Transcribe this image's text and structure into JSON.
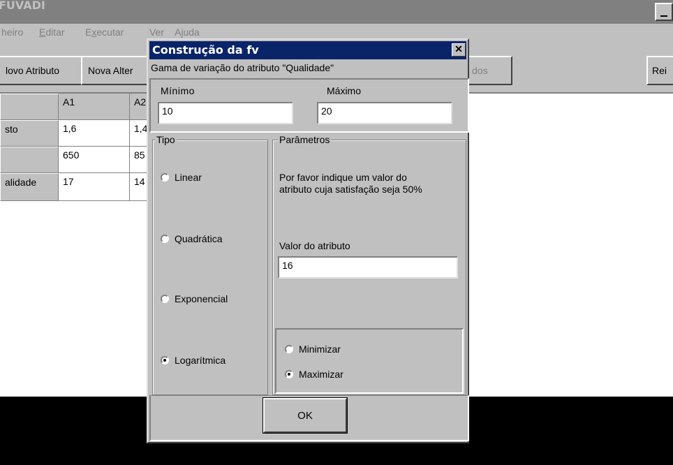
{
  "app": {
    "title": "FUVADI"
  },
  "menu": [
    {
      "label_pre": "",
      "label_ul": "",
      "label_post": "heiro"
    },
    {
      "label_pre": "",
      "label_ul": "E",
      "label_post": "ditar"
    },
    {
      "label_pre": "E",
      "label_ul": "x",
      "label_post": "ecutar"
    },
    {
      "label_pre": "",
      "label_ul": "",
      "label_post": "Ver"
    },
    {
      "label_pre": "",
      "label_ul": "",
      "label_post": "Ajuda"
    }
  ],
  "toolbar": {
    "novo_atributo": "lovo Atributo",
    "nova_alternativa": "Nova Alter",
    "resultados": "dos",
    "reiniciar": "Rei"
  },
  "table": {
    "header": [
      "",
      "A1",
      "A2"
    ],
    "rows": [
      {
        "label": "sto",
        "a1": "1,6",
        "a2": "1,4"
      },
      {
        "label": "",
        "a1": "650",
        "a2": "85"
      },
      {
        "label": "alidade",
        "a1": "17",
        "a2": "14"
      }
    ]
  },
  "dialog": {
    "title": "Construção da fv",
    "close": "✕",
    "subtitle": "Gama de variação do atributo \"Qualidade\"",
    "min_label": "Mínimo",
    "min_value": "10",
    "max_label": "Máximo",
    "max_value": "20",
    "tipo_label": "Tipo",
    "tipo_options": [
      "Linear",
      "Quadrática",
      "Exponencial",
      "Logarítmica"
    ],
    "tipo_selected": "Logarítmica",
    "params_label": "Parâmetros",
    "params_text1": "Por favor indique um valor do",
    "params_text2": "atributo cuja satisfação seja 50%",
    "valor_label": "Valor do atributo",
    "valor_value": "16",
    "objetivo_options": [
      "Minimizar",
      "Maximizar"
    ],
    "objetivo_selected": "Maximizar",
    "ok_label": "OK"
  }
}
